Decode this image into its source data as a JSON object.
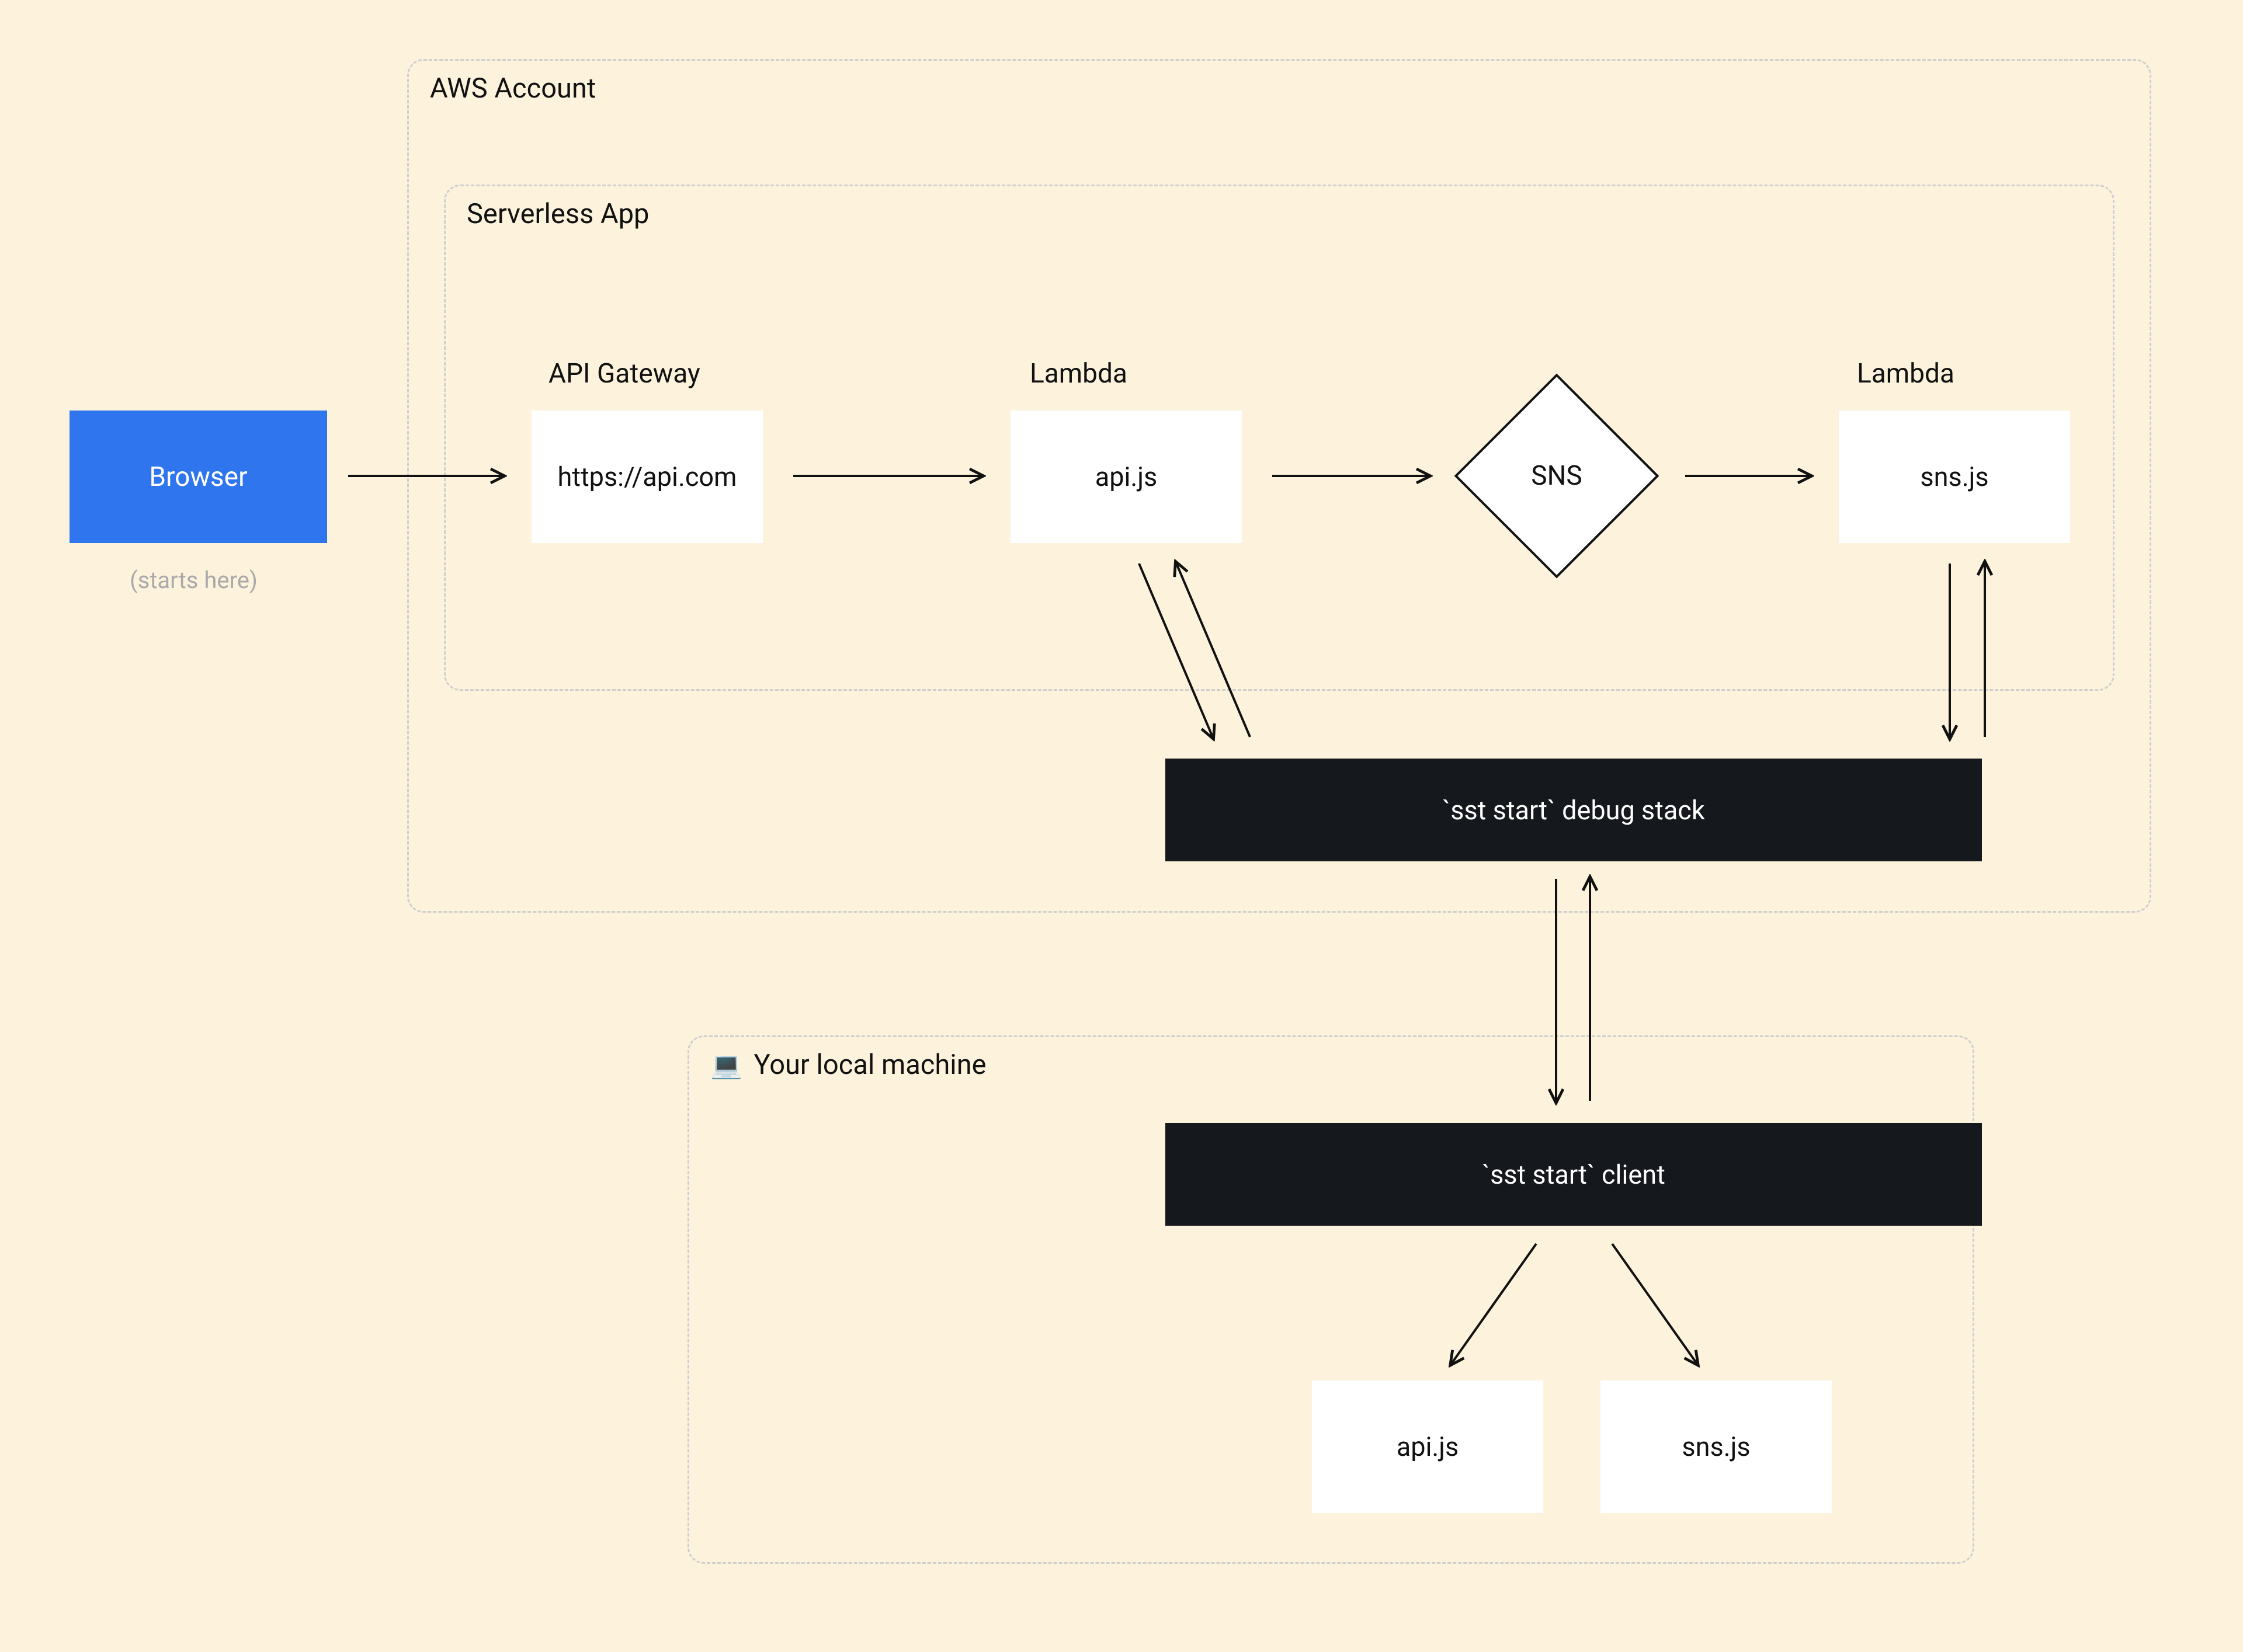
{
  "containers": {
    "aws_account": "AWS Account",
    "serverless_app": "Serverless App",
    "local_machine": "Your local machine"
  },
  "icons": {
    "laptop": "💻"
  },
  "nodes": {
    "browser": "Browser",
    "browser_sub": "(starts here)",
    "api_gateway_title": "API Gateway",
    "api_gateway": "https://api.com",
    "lambda_api_title": "Lambda",
    "lambda_api": "api.js",
    "sns": "SNS",
    "lambda_sns_title": "Lambda",
    "lambda_sns": "sns.js",
    "debug_stack": "`sst start` debug stack",
    "sst_client": "`sst start` client",
    "local_api": "api.js",
    "local_sns": "sns.js"
  }
}
